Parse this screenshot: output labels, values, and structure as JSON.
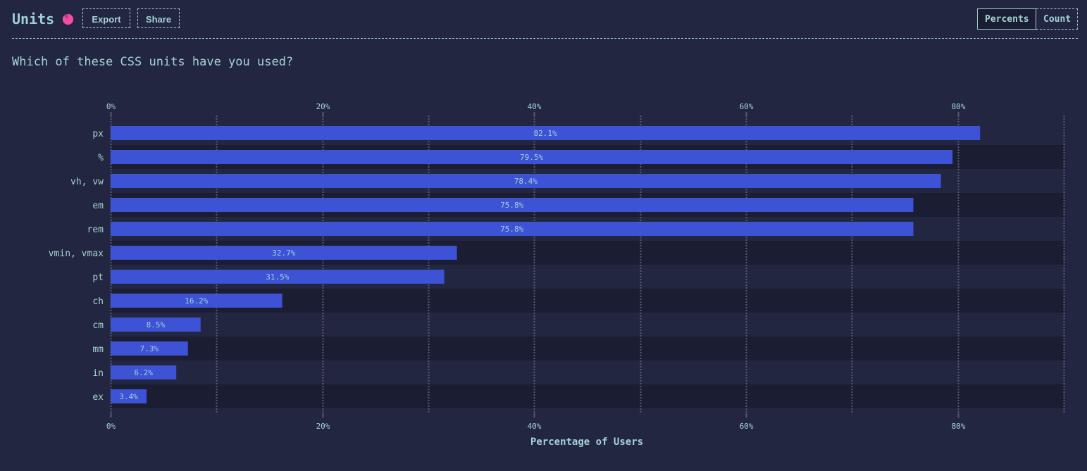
{
  "header": {
    "title": "Units",
    "export_label": "Export",
    "share_label": "Share",
    "toggle": {
      "options": [
        "Percents",
        "Count"
      ],
      "selected": "Percents"
    },
    "icon": "pie-chart-icon",
    "accent_color": "#f04ea0"
  },
  "question": "Which of these CSS units have you used?",
  "colors": {
    "bar": "#3d52d5",
    "row_alt": "#1b1d33",
    "row_base": "#232640",
    "grid": "#575a72"
  },
  "chart_data": {
    "type": "bar",
    "orientation": "horizontal",
    "title": "Which of these CSS units have you used?",
    "xlabel": "Percentage of Users",
    "ylabel": "",
    "categories": [
      "px",
      "%",
      "vh, vw",
      "em",
      "rem",
      "vmin, vmax",
      "pt",
      "ch",
      "cm",
      "mm",
      "in",
      "ex"
    ],
    "values": [
      82.1,
      79.5,
      78.4,
      75.8,
      75.8,
      32.7,
      31.5,
      16.2,
      8.5,
      7.3,
      6.2,
      3.4
    ],
    "value_labels": [
      "82.1%",
      "79.5%",
      "78.4%",
      "75.8%",
      "75.8%",
      "32.7%",
      "31.5%",
      "16.2%",
      "8.5%",
      "7.3%",
      "6.2%",
      "3.4%"
    ],
    "xlim": [
      0,
      90
    ],
    "xticks": [
      0,
      20,
      40,
      60,
      80
    ],
    "xtick_labels": [
      "0%",
      "20%",
      "40%",
      "60%",
      "80%"
    ],
    "minor_grid": [
      10,
      30,
      50,
      70,
      90
    ],
    "grid": true,
    "axis_labels_position": "top-and-bottom",
    "legend": "none"
  }
}
